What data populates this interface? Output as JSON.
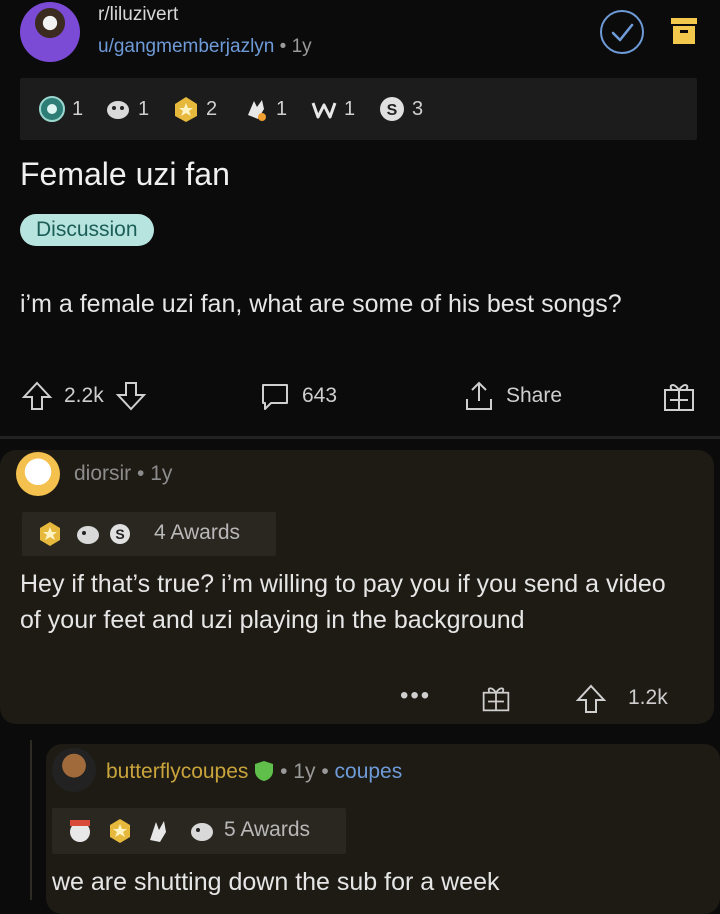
{
  "header": {
    "subreddit": "r/liluzivert",
    "username": "u/gangmemberjazlyn",
    "age": "1y"
  },
  "post": {
    "awards": [
      {
        "icon": "helpful-award-icon",
        "count": "1"
      },
      {
        "icon": "wholesome-seal-award-icon",
        "count": "1"
      },
      {
        "icon": "gold-award-icon",
        "count": "2"
      },
      {
        "icon": "hand-award-icon",
        "count": "1"
      },
      {
        "icon": "w-award-icon",
        "count": "1"
      },
      {
        "icon": "s-coin-award-icon",
        "count": "3"
      }
    ],
    "title": "Female uzi fan",
    "flair": "Discussion",
    "body": "i’m a female uzi fan, what are some of his best songs?",
    "upvotes": "2.2k",
    "comments": "643",
    "share_label": "Share"
  },
  "comments": [
    {
      "username": "diorsir",
      "age": "1y",
      "awards_label": "4 Awards",
      "body": "Hey if that’s true? i’m willing to pay you if you send a video of your feet and uzi playing in the background",
      "more": "•••",
      "score": "1.2k"
    },
    {
      "username": "butterflycoupes",
      "age": "1y",
      "user_flair": "coupes",
      "awards_label": "5 Awards",
      "body": "we are shutting down the sub for a week"
    }
  ],
  "colors": {
    "background": "#0b0b0b",
    "username_blue": "#6e9bd8",
    "flair_bg": "#b7e4de",
    "mod_name": "#c9a43c",
    "comment_bg": "#1d1b14"
  }
}
